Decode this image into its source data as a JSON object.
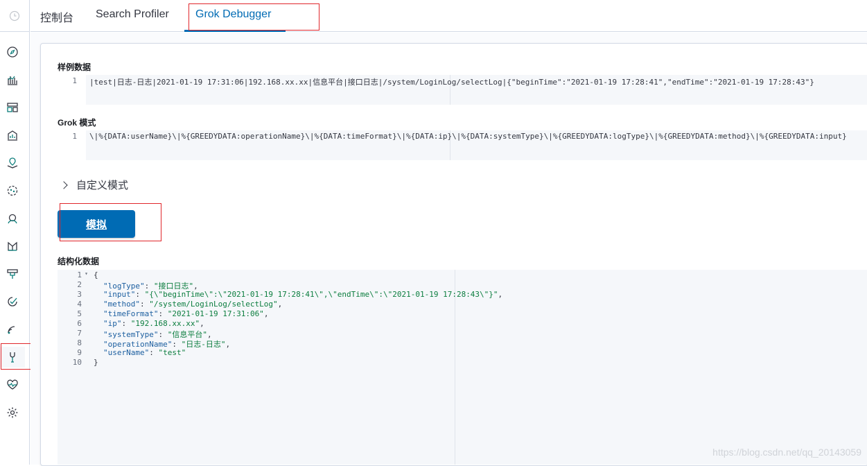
{
  "tabs": [
    {
      "label": "控制台"
    },
    {
      "label": "Search Profiler"
    },
    {
      "label": "Grok Debugger"
    }
  ],
  "sample_data": {
    "label": "样例数据",
    "line_number": "1",
    "text": "|test|日志-日志|2021-01-19 17:31:06|192.168.xx.xx|信息平台|接口日志|/system/LoginLog/selectLog|{\"beginTime\":\"2021-01-19 17:28:41\",\"endTime\":\"2021-01-19 17:28:43\"}"
  },
  "grok_pattern": {
    "label": "Grok 模式",
    "line_number": "1",
    "text": "\\|%{DATA:userName}\\|%{GREEDYDATA:operationName}\\|%{DATA:timeFormat}\\|%{DATA:ip}\\|%{DATA:systemType}\\|%{GREEDYDATA:logType}\\|%{GREEDYDATA:method}\\|%{GREEDYDATA:input}"
  },
  "custom_patterns": {
    "label": "自定义模式"
  },
  "simulate_button": {
    "label": "模拟"
  },
  "structured_data": {
    "label": "结构化数据",
    "open_brace": "{",
    "close_brace": "}",
    "line_numbers": [
      "1",
      "2",
      "3",
      "4",
      "5",
      "6",
      "7",
      "8",
      "9",
      "10"
    ],
    "fields": [
      {
        "key": "\"logType\"",
        "value": "\"接口日志\"",
        "sep": ","
      },
      {
        "key": "\"input\"",
        "value": "\"{\\\"beginTime\\\":\\\"2021-01-19 17:28:41\\\",\\\"endTime\\\":\\\"2021-01-19 17:28:43\\\"}\"",
        "sep": ","
      },
      {
        "key": "\"method\"",
        "value": "\"/system/LoginLog/selectLog\"",
        "sep": ","
      },
      {
        "key": "\"timeFormat\"",
        "value": "\"2021-01-19 17:31:06\"",
        "sep": ","
      },
      {
        "key": "\"ip\"",
        "value": "\"192.168.xx.xx\"",
        "sep": ","
      },
      {
        "key": "\"systemType\"",
        "value": "\"信息平台\"",
        "sep": ","
      },
      {
        "key": "\"operationName\"",
        "value": "\"日志-日志\"",
        "sep": ","
      },
      {
        "key": "\"userName\"",
        "value": "\"test\"",
        "sep": ""
      }
    ]
  },
  "nav_icons": [
    "clock-icon",
    "compass-icon",
    "visualize-icon",
    "dashboard-icon",
    "canvas-icon",
    "maps-icon",
    "ml-icon",
    "graph-icon",
    "apm-icon",
    "infra-icon",
    "uptime-icon",
    "siem-icon",
    "dev-tools-icon",
    "monitoring-icon",
    "gear-icon"
  ],
  "watermark": "https://blog.csdn.net/qq_20143059",
  "colors": {
    "accent": "#006bb4",
    "highlight_box": "#e0262b"
  }
}
